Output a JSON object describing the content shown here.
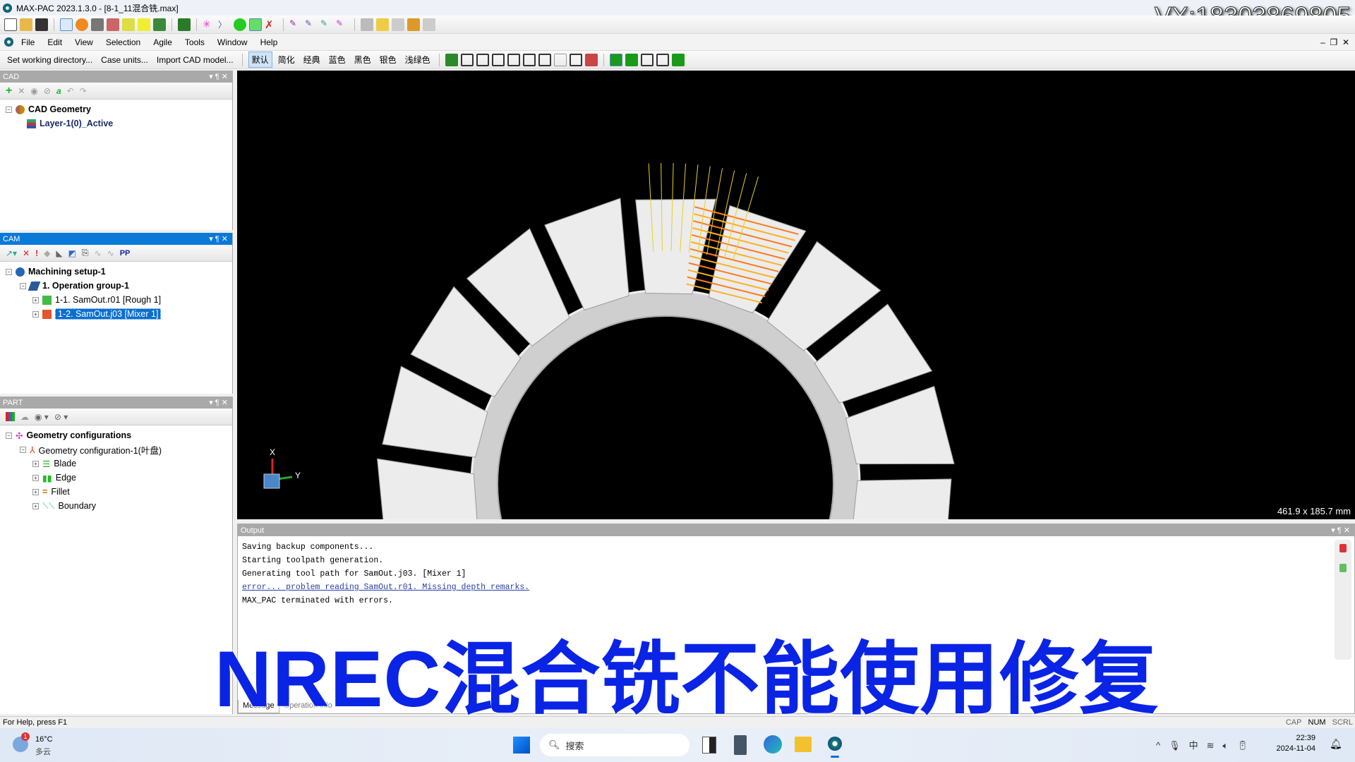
{
  "window": {
    "title": "MAX-PAC 2023.1.3.0 - [8-1_11混合铣.max]"
  },
  "watermark": "VX:18303869805",
  "menu": [
    "File",
    "Edit",
    "View",
    "Selection",
    "Agile",
    "Tools",
    "Window",
    "Help"
  ],
  "toolbar3": {
    "commands": [
      "Set working directory...",
      "Case units...",
      "Import CAD model..."
    ],
    "themes": [
      "默认",
      "简化",
      "经典",
      "蓝色",
      "黑色",
      "银色",
      "浅绿色"
    ],
    "active_theme": "默认"
  },
  "cad_panel": {
    "title": "CAD",
    "root": "CAD Geometry",
    "layer": "Layer-1(0)_Active"
  },
  "cam_panel": {
    "title": "CAM",
    "pp_label": "PP",
    "setup": "Machining setup-1",
    "group": "1. Operation group-1",
    "ops": [
      "1-1. SamOut.r01 [Rough 1]",
      "1-2. SamOut.j03 [Mixer 1]"
    ]
  },
  "part_panel": {
    "title": "PART",
    "root": "Geometry configurations",
    "config": "Geometry configuration-1(叶盘)",
    "items": [
      "Blade",
      "Edge",
      "Fillet",
      "Boundary"
    ]
  },
  "viewport": {
    "dims": "461.9 x 185.7 mm",
    "axis_x": "X",
    "axis_y": "Y"
  },
  "output": {
    "title": "Output",
    "lines": [
      "Saving backup components...",
      "Starting toolpath generation.",
      "Generating tool path for SamOut.j03. [Mixer 1]",
      "error... problem reading SamOut.r01. Missing depth remarks.",
      "MAX_PAC terminated with errors."
    ],
    "tabs": [
      "Message",
      "Operation info"
    ]
  },
  "status": {
    "help": "For Help, press F1",
    "indicators": [
      "CAP",
      "NUM",
      "SCRL"
    ]
  },
  "taskbar": {
    "weather_temp": "16°C",
    "weather_desc": "多云",
    "weather_badge": "1",
    "search": "搜索",
    "time": "22:39",
    "date": "2024-11-04"
  },
  "caption": "NREC混合铣不能使用修复",
  "colors": {
    "accent": "#0a7ad8",
    "caption": "#0a24e6",
    "error_link": "#2b3fa8"
  }
}
